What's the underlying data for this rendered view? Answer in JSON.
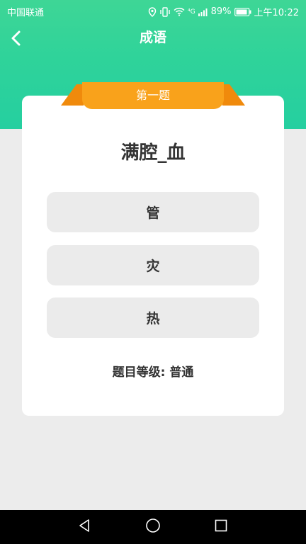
{
  "status_bar": {
    "carrier": "中国联通",
    "network": "⁴G",
    "battery": "89%",
    "time": "上午10:22",
    "icons": [
      "location-icon",
      "vibrate-icon",
      "wifi-icon",
      "signal-icon",
      "battery-icon"
    ]
  },
  "header": {
    "title": "成语",
    "back_icon": "chevron-left-icon"
  },
  "colors": {
    "header_green_top": "#3ed696",
    "header_green_bottom": "#25cfa0",
    "ribbon_orange": "#f9a21b",
    "ribbon_fold": "#f08a0c",
    "option_bg": "#ebebeb",
    "text_dark": "#333333",
    "page_bg": "#ececec"
  },
  "quiz": {
    "ribbon_label": "第一题",
    "question": "满腔_血",
    "options": [
      "管",
      "灾",
      "热"
    ],
    "level_label": "题目等级: 普通"
  },
  "nav_bar": {
    "icons": [
      "back-triangle-icon",
      "home-circle-icon",
      "recents-square-icon"
    ]
  }
}
